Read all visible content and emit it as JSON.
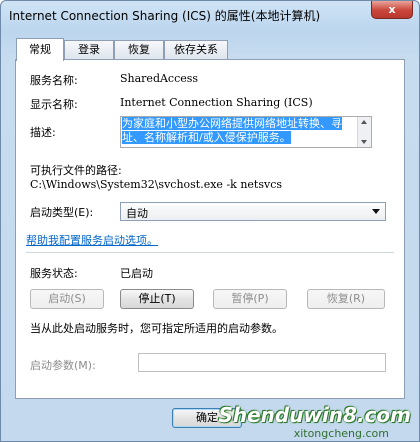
{
  "window": {
    "title": "Internet Connection Sharing (ICS) 的属性(本地计算机)",
    "close_symbol": "x"
  },
  "tabs": [
    {
      "label": "常规",
      "active": true
    },
    {
      "label": "登录",
      "active": false
    },
    {
      "label": "恢复",
      "active": false
    },
    {
      "label": "依存关系",
      "active": false
    }
  ],
  "general": {
    "service_name_label": "服务名称:",
    "service_name_value": "SharedAccess",
    "display_name_label": "显示名称:",
    "display_name_value": "Internet Connection Sharing (ICS)",
    "description_label": "描述:",
    "description_value": "为家庭和小型办公网络提供网络地址转换、寻址、名称解析和/或入侵保护服务。",
    "executable_label": "可执行文件的路径:",
    "executable_value": "C:\\Windows\\System32\\svchost.exe -k netsvcs",
    "startup_type_label": "启动类型(E):",
    "startup_type_value": "自动",
    "help_link": "帮助我配置服务启动选项。",
    "status_label": "服务状态:",
    "status_value": "已启动",
    "start_button": "启动(S)",
    "stop_button": "停止(T)",
    "pause_button": "暂停(P)",
    "resume_button": "恢复(R)",
    "hint_text": "当从此处启动服务时，您可指定所适用的启动参数。",
    "params_label": "启动参数(M):",
    "params_value": ""
  },
  "footer": {
    "ok_button": "确定"
  },
  "watermark": {
    "main": "Shenduwin8.com",
    "sub": "xitongcheng.com"
  }
}
